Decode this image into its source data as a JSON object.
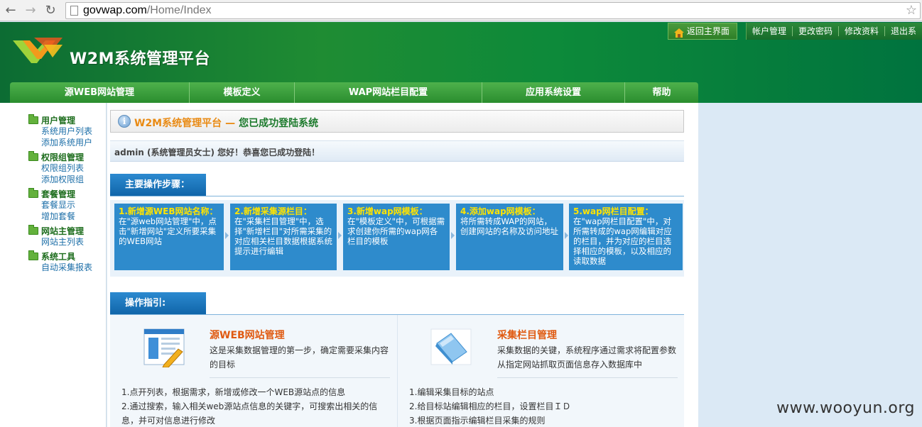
{
  "browser": {
    "url_host": "govwap.com",
    "url_path": "/Home/Index"
  },
  "header": {
    "title": "W2M系统管理平台",
    "home_label": "返回主界面",
    "account_links": [
      "帐户管理",
      "更改密码",
      "修改资料",
      "退出系"
    ]
  },
  "main_nav": [
    "源WEB网站管理",
    "模板定义",
    "WAP网站栏目配置",
    "应用系统设置",
    "帮助"
  ],
  "sidebar": {
    "groups": [
      {
        "title": "用户管理",
        "links": [
          "系统用户列表",
          "添加系统用户"
        ]
      },
      {
        "title": "权限组管理",
        "links": [
          "权限组列表",
          "添加权限组"
        ]
      },
      {
        "title": "套餐管理",
        "links": [
          "套餐显示",
          "增加套餐"
        ]
      },
      {
        "title": "网站主管理",
        "links": [
          "网站主列表"
        ]
      },
      {
        "title": "系统工具",
        "links": [
          "自动采集报表"
        ]
      }
    ]
  },
  "welcome": {
    "brand": "W2M系统管理平台",
    "separator": "—",
    "message": "您已成功登陆系统"
  },
  "user_greeting": "admin (系统管理员女士) 您好！恭喜您已成功登陆！",
  "steps_section": {
    "title": "主要操作步骤：",
    "steps": [
      {
        "title": "1.新增源WEB网站名称：",
        "desc": "在\"源web网站管理\"中，点击\"新增网站\"定义所要采集的WEB网站"
      },
      {
        "title": "2.新增采集源栏目：",
        "desc": "在\"采集栏目管理\"中，选择\"新增栏目\"对所需采集的对应相关栏目数据根据系统提示进行编辑"
      },
      {
        "title": "3.新增wap网模板：",
        "desc": "在\"模板定义\"中，可根据需求创建你所需的wap网各栏目的模板"
      },
      {
        "title": "4.添加wap网模板：",
        "desc": "将所需转成WAP的网站，创建网站的名称及访问地址"
      },
      {
        "title": "5.wap网栏目配置：",
        "desc": "在\"wap网栏目配置\"中，对所需转成的wap网编辑对应的栏目，并为对应的栏目选择相应的模板，以及相应的读取数据"
      }
    ]
  },
  "guide_section": {
    "title": "操作指引:",
    "items": [
      {
        "title": "源WEB网站管理",
        "desc": "这是采集数据管理的第一步，确定需要采集内容的目标",
        "list": [
          "1.点开列表，根据需求，新增或修改一个WEB源站点的信息",
          "2.通过搜索，输入相关web源站点信息的关键字，可搜索出相关的信息，并可对信息进行修改"
        ]
      },
      {
        "title": "采集栏目管理",
        "desc": "采集数据的关键，系统程序通过需求将配置参数从指定网站抓取页面信息存入数据库中",
        "list": [
          "1.编辑采集目标的站点",
          "2.给目标站编辑相应的栏目，设置栏目ＩＤ",
          "3.根据页面指示编辑栏目采集的规则"
        ]
      }
    ]
  },
  "watermark": "www.wooyun.org"
}
